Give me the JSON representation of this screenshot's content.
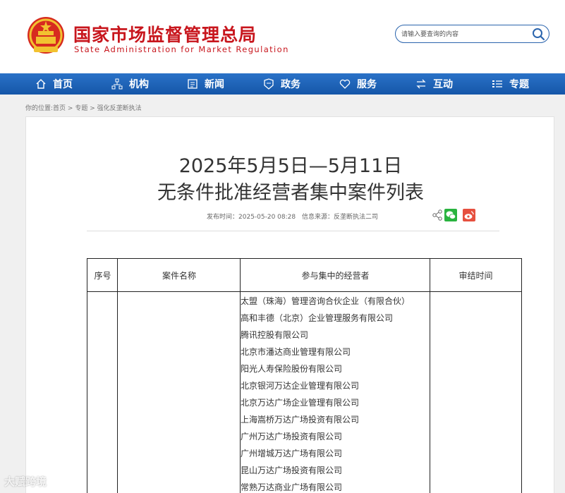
{
  "header": {
    "logo_cn": "国家市场监督管理总局",
    "logo_en": "State Administration for Market Regulation"
  },
  "search": {
    "placeholder": "请输入要查询的内容"
  },
  "nav": [
    {
      "label": "首页",
      "icon": "home-icon"
    },
    {
      "label": "机构",
      "icon": "org-icon"
    },
    {
      "label": "新闻",
      "icon": "news-icon"
    },
    {
      "label": "政务",
      "icon": "affairs-icon"
    },
    {
      "label": "服务",
      "icon": "heart-icon"
    },
    {
      "label": "互动",
      "icon": "exchange-icon"
    },
    {
      "label": "专题",
      "icon": "list-icon"
    }
  ],
  "breadcrumb": {
    "prefix": "你的位置:",
    "items": [
      "首页",
      "专题",
      "强化反垄断执法"
    ],
    "sep": " > "
  },
  "article": {
    "title_line1": "2025年5月5日—5月11日",
    "title_line2": "无条件批准经营者集中案件列表",
    "publish_label": "发布时间：",
    "publish_time": "2025-05-20 08:28",
    "source_label": "信息来源：",
    "source": "反垄断执法二司"
  },
  "table": {
    "headers": [
      "序号",
      "案件名称",
      "参与集中的经营者",
      "审结时间"
    ],
    "parties": [
      "太盟（珠海）管理咨询合伙企业（有限合伙）",
      "高和丰德（北京）企业管理服务有限公司",
      "腾讯控股有限公司",
      "北京市潘达商业管理有限公司",
      "阳光人寿保险股份有限公司",
      "北京银河万达企业管理有限公司",
      "北京万达广场企业管理有限公司",
      "上海嵩桥万达广场投资有限公司",
      "广州万达广场投资有限公司",
      "广州增城万达广场有限公司",
      "昆山万达广场投资有限公司",
      "常熟万达商业广场有限公司"
    ]
  },
  "watermark": "大赋跨境",
  "colors": {
    "brand_red": "#c8161d",
    "nav_blue": "#1a5fb4",
    "wechat_green": "#29b33f",
    "weibo_red": "#e6503f"
  }
}
